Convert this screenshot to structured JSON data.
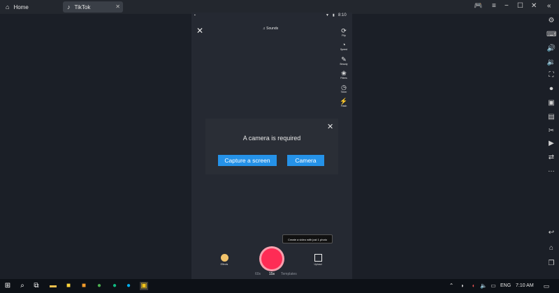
{
  "window": {
    "tabs": [
      {
        "label": "Home",
        "icon": "home-icon"
      },
      {
        "label": "TikTok",
        "icon": "tiktok-icon"
      }
    ]
  },
  "phone": {
    "status_time": "8:10",
    "sounds_label": "Sounds",
    "tools": [
      "Flip",
      "Speed",
      "Beauty",
      "Filters",
      "Timer",
      "Flash"
    ],
    "dialog": {
      "title": "A camera is required",
      "capture_label": "Capture a screen",
      "camera_label": "Camera"
    },
    "tooltip": "Create a video with just 1 photo",
    "effects_label": "Effects",
    "upload_label": "Upload",
    "modes": [
      "60s",
      "15s",
      "Templates"
    ],
    "active_mode": "15s"
  },
  "taskbar": {
    "language": "ENG",
    "time": "7:10 AM"
  },
  "colors": {
    "record": "#fe2c55",
    "button": "#2592e8"
  }
}
